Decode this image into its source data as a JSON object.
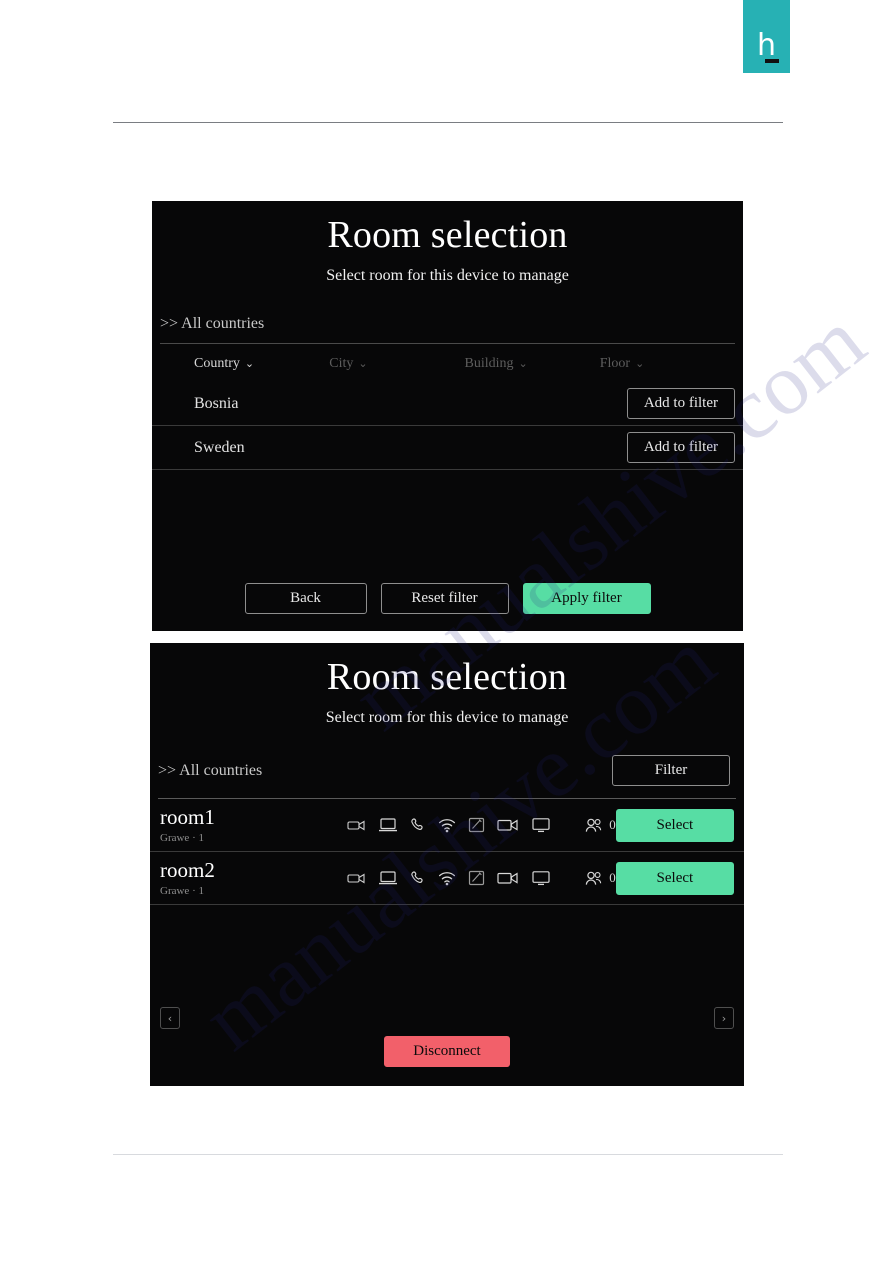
{
  "document": {
    "logo_letter": "h"
  },
  "watermark": {
    "text_a": "manualshive.com",
    "text_b": "manualshive.com"
  },
  "filter_panel": {
    "title": "Room selection",
    "subtitle": "Select room for this device to manage",
    "breadcrumb": ">> All countries",
    "columns": [
      {
        "label": "Country",
        "caret": "⌄",
        "active": true
      },
      {
        "label": "City",
        "caret": "⌄",
        "active": false
      },
      {
        "label": "Building",
        "caret": "⌄",
        "active": false
      },
      {
        "label": "Floor",
        "caret": "⌄",
        "active": false
      }
    ],
    "rows": [
      {
        "name": "Bosnia",
        "action": "Add to filter"
      },
      {
        "name": "Sweden",
        "action": "Add to filter"
      }
    ],
    "footer": {
      "back": "Back",
      "reset": "Reset filter",
      "apply": "Apply filter"
    }
  },
  "rooms_panel": {
    "title": "Room selection",
    "subtitle": "Select room for this device to manage",
    "breadcrumb": ">> All countries",
    "filter_button": "Filter",
    "device_icons": [
      "projector-icon",
      "laptop-icon",
      "phone-icon",
      "wifi-icon",
      "whiteboard-icon",
      "video-camera-icon",
      "monitor-icon"
    ],
    "rooms": [
      {
        "name": "room1",
        "subtitle": "Grawe · 1",
        "people_count": "0",
        "select": "Select"
      },
      {
        "name": "room2",
        "subtitle": "Grawe · 1",
        "people_count": "0",
        "select": "Select"
      }
    ],
    "pager": {
      "prev": "‹",
      "next": "›"
    },
    "disconnect": "Disconnect"
  },
  "colors": {
    "brand_teal": "#27b1b4",
    "accent_green": "#57dda4",
    "danger_red": "#f2606a",
    "panel_bg": "#070708"
  }
}
